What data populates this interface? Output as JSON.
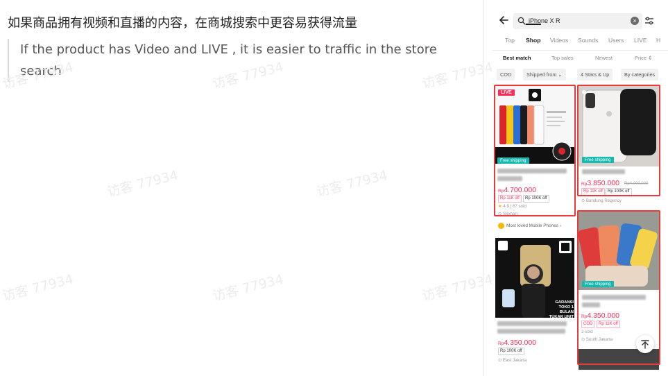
{
  "doc": {
    "heading": "如果商品拥有视频和直播的内容，在商城搜索中更容易获得流量",
    "quote": "If the product has Video and LIVE , it is easier to traffic in the store search",
    "watermark": "访客 77934"
  },
  "phone": {
    "search": {
      "query": "iPhone X R",
      "clear_glyph": "×"
    },
    "tabs": [
      "Top",
      "Shop",
      "Videos",
      "Sounds",
      "Users",
      "LIVE",
      "H"
    ],
    "active_tab": "Shop",
    "sorts": [
      "Best match",
      "Top sales",
      "Newest",
      "Price ⇕"
    ],
    "chips": [
      "COD",
      "Shipped from ⌄",
      "4 Stars & Up",
      "By categories"
    ],
    "products": [
      {
        "live_label": "LIVE",
        "shipping": "Free shipping",
        "price_prefix": "Rp",
        "price": "4.700.000",
        "tags": [
          "Rp 11K off",
          "Rp 100K off"
        ],
        "rating": "4.9 | 67 sold",
        "location": "Sleman"
      },
      {
        "shipping": "Free shipping",
        "price_prefix": "Rp",
        "price": "3.850.000",
        "old_price": "Rp4.000.000",
        "tags": [
          "Rp 11K off",
          "Rp 100K off"
        ],
        "location": "Bandung Regency"
      },
      {
        "shop_banner": "Most loved  Mobile Phones",
        "guarantee_text": "GARANSI TOKO 1 BULAN TUKAR UNIT",
        "price_prefix": "Rp",
        "price": "4.350.000",
        "tags": [
          "Rp 100K off"
        ],
        "location": "East Jakarta"
      },
      {
        "shipping": "Free shipping",
        "price_prefix": "Rp",
        "price": "4.350.000",
        "tags": [
          "COD",
          "Rp 11K off"
        ],
        "sold": "2 sold",
        "location": "South Jakarta"
      }
    ],
    "colors": {
      "highlight": "#e83a3a",
      "price": "#fe2c55",
      "shipping": "#16b8b0"
    }
  }
}
